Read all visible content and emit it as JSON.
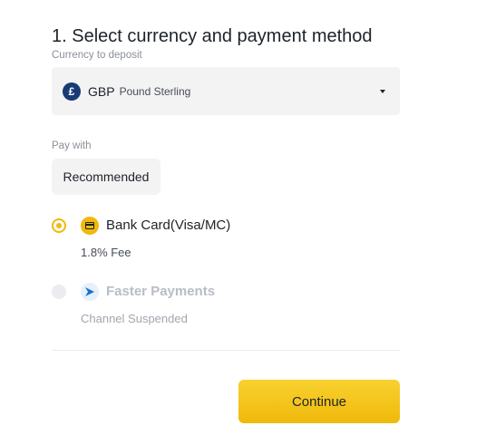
{
  "title": "1. Select currency and payment method",
  "currency": {
    "label": "Currency to deposit",
    "icon_symbol": "£",
    "code": "GBP",
    "name": "Pound Sterling",
    "icon": "caret-down-icon"
  },
  "pay_with": {
    "label": "Pay with",
    "tab": "Recommended"
  },
  "methods": [
    {
      "name": "Bank Card(Visa/MC)",
      "sub": "1.8% Fee",
      "icon": "bank-card-icon",
      "selected": true,
      "disabled": false
    },
    {
      "name": "Faster Payments",
      "sub": "Channel Suspended",
      "icon": "faster-payments-icon",
      "selected": false,
      "disabled": true
    }
  ],
  "continue_label": "Continue",
  "colors": {
    "accent": "#f0b90b",
    "text": "#1e2329",
    "muted": "#8a8f98",
    "field_bg": "#f3f3f4"
  }
}
